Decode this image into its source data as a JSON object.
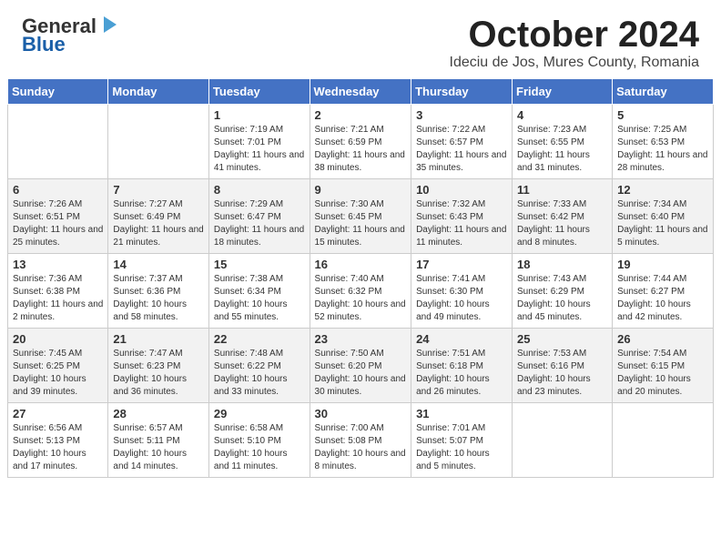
{
  "header": {
    "logo_line1": "General",
    "logo_line2": "Blue",
    "month_title": "October 2024",
    "subtitle": "Ideciu de Jos, Mures County, Romania"
  },
  "days_of_week": [
    "Sunday",
    "Monday",
    "Tuesday",
    "Wednesday",
    "Thursday",
    "Friday",
    "Saturday"
  ],
  "weeks": [
    [
      {
        "day": "",
        "info": ""
      },
      {
        "day": "",
        "info": ""
      },
      {
        "day": "1",
        "info": "Sunrise: 7:19 AM\nSunset: 7:01 PM\nDaylight: 11 hours and 41 minutes."
      },
      {
        "day": "2",
        "info": "Sunrise: 7:21 AM\nSunset: 6:59 PM\nDaylight: 11 hours and 38 minutes."
      },
      {
        "day": "3",
        "info": "Sunrise: 7:22 AM\nSunset: 6:57 PM\nDaylight: 11 hours and 35 minutes."
      },
      {
        "day": "4",
        "info": "Sunrise: 7:23 AM\nSunset: 6:55 PM\nDaylight: 11 hours and 31 minutes."
      },
      {
        "day": "5",
        "info": "Sunrise: 7:25 AM\nSunset: 6:53 PM\nDaylight: 11 hours and 28 minutes."
      }
    ],
    [
      {
        "day": "6",
        "info": "Sunrise: 7:26 AM\nSunset: 6:51 PM\nDaylight: 11 hours and 25 minutes."
      },
      {
        "day": "7",
        "info": "Sunrise: 7:27 AM\nSunset: 6:49 PM\nDaylight: 11 hours and 21 minutes."
      },
      {
        "day": "8",
        "info": "Sunrise: 7:29 AM\nSunset: 6:47 PM\nDaylight: 11 hours and 18 minutes."
      },
      {
        "day": "9",
        "info": "Sunrise: 7:30 AM\nSunset: 6:45 PM\nDaylight: 11 hours and 15 minutes."
      },
      {
        "day": "10",
        "info": "Sunrise: 7:32 AM\nSunset: 6:43 PM\nDaylight: 11 hours and 11 minutes."
      },
      {
        "day": "11",
        "info": "Sunrise: 7:33 AM\nSunset: 6:42 PM\nDaylight: 11 hours and 8 minutes."
      },
      {
        "day": "12",
        "info": "Sunrise: 7:34 AM\nSunset: 6:40 PM\nDaylight: 11 hours and 5 minutes."
      }
    ],
    [
      {
        "day": "13",
        "info": "Sunrise: 7:36 AM\nSunset: 6:38 PM\nDaylight: 11 hours and 2 minutes."
      },
      {
        "day": "14",
        "info": "Sunrise: 7:37 AM\nSunset: 6:36 PM\nDaylight: 10 hours and 58 minutes."
      },
      {
        "day": "15",
        "info": "Sunrise: 7:38 AM\nSunset: 6:34 PM\nDaylight: 10 hours and 55 minutes."
      },
      {
        "day": "16",
        "info": "Sunrise: 7:40 AM\nSunset: 6:32 PM\nDaylight: 10 hours and 52 minutes."
      },
      {
        "day": "17",
        "info": "Sunrise: 7:41 AM\nSunset: 6:30 PM\nDaylight: 10 hours and 49 minutes."
      },
      {
        "day": "18",
        "info": "Sunrise: 7:43 AM\nSunset: 6:29 PM\nDaylight: 10 hours and 45 minutes."
      },
      {
        "day": "19",
        "info": "Sunrise: 7:44 AM\nSunset: 6:27 PM\nDaylight: 10 hours and 42 minutes."
      }
    ],
    [
      {
        "day": "20",
        "info": "Sunrise: 7:45 AM\nSunset: 6:25 PM\nDaylight: 10 hours and 39 minutes."
      },
      {
        "day": "21",
        "info": "Sunrise: 7:47 AM\nSunset: 6:23 PM\nDaylight: 10 hours and 36 minutes."
      },
      {
        "day": "22",
        "info": "Sunrise: 7:48 AM\nSunset: 6:22 PM\nDaylight: 10 hours and 33 minutes."
      },
      {
        "day": "23",
        "info": "Sunrise: 7:50 AM\nSunset: 6:20 PM\nDaylight: 10 hours and 30 minutes."
      },
      {
        "day": "24",
        "info": "Sunrise: 7:51 AM\nSunset: 6:18 PM\nDaylight: 10 hours and 26 minutes."
      },
      {
        "day": "25",
        "info": "Sunrise: 7:53 AM\nSunset: 6:16 PM\nDaylight: 10 hours and 23 minutes."
      },
      {
        "day": "26",
        "info": "Sunrise: 7:54 AM\nSunset: 6:15 PM\nDaylight: 10 hours and 20 minutes."
      }
    ],
    [
      {
        "day": "27",
        "info": "Sunrise: 6:56 AM\nSunset: 5:13 PM\nDaylight: 10 hours and 17 minutes."
      },
      {
        "day": "28",
        "info": "Sunrise: 6:57 AM\nSunset: 5:11 PM\nDaylight: 10 hours and 14 minutes."
      },
      {
        "day": "29",
        "info": "Sunrise: 6:58 AM\nSunset: 5:10 PM\nDaylight: 10 hours and 11 minutes."
      },
      {
        "day": "30",
        "info": "Sunrise: 7:00 AM\nSunset: 5:08 PM\nDaylight: 10 hours and 8 minutes."
      },
      {
        "day": "31",
        "info": "Sunrise: 7:01 AM\nSunset: 5:07 PM\nDaylight: 10 hours and 5 minutes."
      },
      {
        "day": "",
        "info": ""
      },
      {
        "day": "",
        "info": ""
      }
    ]
  ]
}
